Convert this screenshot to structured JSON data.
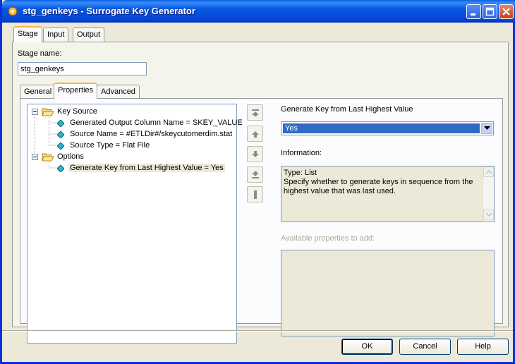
{
  "window": {
    "title": "stg_genkeys - Surrogate Key Generator",
    "controls": [
      "minimize-icon",
      "maximize-icon",
      "close-icon"
    ]
  },
  "top_tabs": [
    {
      "label": "Stage",
      "active": true
    },
    {
      "label": "Input",
      "active": false
    },
    {
      "label": "Output",
      "active": false
    }
  ],
  "stage": {
    "name_label": "Stage name:",
    "name_value": "stg_genkeys"
  },
  "inner_tabs": [
    {
      "label": "General",
      "active": false
    },
    {
      "label": "Properties",
      "active": true
    },
    {
      "label": "Advanced",
      "active": false
    }
  ],
  "tree": {
    "groups": [
      {
        "label": "Key Source",
        "expander": "minus",
        "items": [
          "Generated Output Column Name = SKEY_VALUE",
          "Source Name = #ETLDir#/skeycutomerdim.stat",
          "Source Type = Flat File"
        ]
      },
      {
        "label": "Options",
        "expander": "minus",
        "items": [
          "Generate Key from Last Highest Value = Yes"
        ]
      }
    ],
    "selected": "Generate Key from Last Highest Value = Yes"
  },
  "side_buttons": [
    "move-top-icon",
    "move-up-icon",
    "move-down-icon",
    "move-bottom-icon",
    "properties-bar-icon"
  ],
  "property": {
    "name_label": "Generate Key from Last Highest Value",
    "selected_value": "Yes",
    "info_label": "Information:",
    "info_line1": "Type: List",
    "info_line2": "Specify whether to generate keys in sequence from the highest value that was last used.",
    "available_label": "Available properties to add:"
  },
  "buttons": {
    "ok": "OK",
    "cancel": "Cancel",
    "help": "Help"
  },
  "colors": {
    "titlebar": "#0656e2",
    "selection": "#316ac5",
    "dialog_bg": "#ece9d8"
  }
}
